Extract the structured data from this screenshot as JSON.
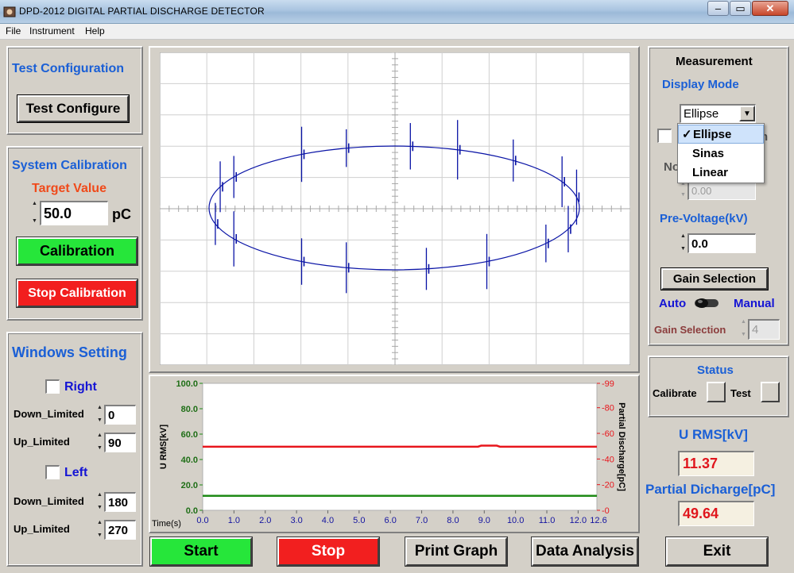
{
  "window": {
    "title": "DPD-2012   DIGITAL  PARTIAL  DISCHARGE  DETECTOR",
    "minimize_glyph": "–",
    "maximize_glyph": "▭",
    "close_glyph": "✕"
  },
  "menu": [
    "File",
    "Instrument",
    "Help"
  ],
  "test_config": {
    "heading": "Test  Configuration",
    "button": "Test Configure"
  },
  "calibration": {
    "heading": "System Calibration",
    "target_label": "Target Value",
    "target_value": "50.0",
    "unit": "pC",
    "calibrate_button": "Calibration",
    "stop_button": "Stop Calibration"
  },
  "windows_setting": {
    "heading": "Windows Setting",
    "right_label": "Right",
    "left_label": "Left",
    "down_label": "Down_Limited",
    "up_label": "Up_Limited",
    "right_down": "0",
    "right_up": "90",
    "left_down": "180",
    "left_up": "270"
  },
  "measurement": {
    "heading": "Measurement",
    "display_mode_label": "Display Mode",
    "display_mode_value": "Ellipse",
    "display_mode_options": [
      "Ellipse",
      "Sinas",
      "Linear"
    ],
    "checkmark": "✓",
    "hidden_label_partial": "No",
    "hidden_label_tail": "n",
    "noise_value": "0.00",
    "pre_voltage_label": "Pre-Voltage(kV)",
    "pre_voltage_value": "0.0",
    "gain_button": "Gain Selection",
    "auto_label": "Auto",
    "manual_label": "Manual",
    "gain_label": "Gain Selection",
    "gain_value": "4"
  },
  "status": {
    "heading": "Status",
    "calibrate_label": "Calibrate",
    "test_label": "Test"
  },
  "readouts": {
    "urms_label": "U RMS[kV]",
    "urms_value": "11.37",
    "pd_label": "Partial Dicharge[pC]",
    "pd_value": "49.64"
  },
  "bottom_buttons": {
    "start": "Start",
    "stop": "Stop",
    "print": "Print Graph",
    "analysis": "Data Analysis",
    "exit": "Exit"
  },
  "colors": {
    "accent_blue": "#1a5fd6",
    "start_green": "#26e63a",
    "stop_red": "#f21f1f",
    "trace_blue": "#0a14a6",
    "pd_red": "#e8161c",
    "urms_green": "#1e8a16"
  },
  "chart_data": [
    {
      "type": "scatter",
      "description_mode": "Ellipse",
      "x_range": [
        0,
        360
      ],
      "ellipse_semi_axes": [
        1.0,
        1.0
      ],
      "pulses": [
        {
          "phase": 20,
          "amp": 0.8
        },
        {
          "phase": 30,
          "amp": 0.6
        },
        {
          "phase": 60,
          "amp": 0.9
        },
        {
          "phase": 75,
          "amp": 0.5
        },
        {
          "phase": 95,
          "amp": 0.7
        },
        {
          "phase": 110,
          "amp": 1.0
        },
        {
          "phase": 130,
          "amp": 0.6
        },
        {
          "phase": 155,
          "amp": 0.8
        },
        {
          "phase": 170,
          "amp": 0.9
        },
        {
          "phase": 200,
          "amp": 0.7
        },
        {
          "phase": 215,
          "amp": 0.5
        },
        {
          "phase": 240,
          "amp": 0.9
        },
        {
          "phase": 260,
          "amp": 0.6
        },
        {
          "phase": 285,
          "amp": 0.8
        },
        {
          "phase": 300,
          "amp": 0.7
        },
        {
          "phase": 330,
          "amp": 0.9
        },
        {
          "phase": 345,
          "amp": 0.6
        }
      ]
    },
    {
      "type": "line",
      "xlabel": "Time(s)",
      "ylabel_left": "U RMS[kV]",
      "ylabel_right": "Partial Discharge[pC]",
      "x_ticks": [
        "0.0",
        "1.0",
        "2.0",
        "3.0",
        "4.0",
        "5.0",
        "6.0",
        "7.0",
        "8.0",
        "9.0",
        "10.0",
        "11.0",
        "12.0"
      ],
      "x_end_label": "12.6",
      "xlim": [
        0,
        12.6
      ],
      "y_left_ticks": [
        "100.0",
        "80.0",
        "60.0",
        "40.0",
        "20.0",
        "0.0"
      ],
      "y_right_ticks": [
        "99",
        "80",
        "60",
        "40",
        "20",
        "0"
      ],
      "ylim_left": [
        0,
        100
      ],
      "ylim_right": [
        0,
        99
      ],
      "series": [
        {
          "name": "U RMS[kV]",
          "axis": "left",
          "x": [
            0,
            12.6
          ],
          "y": [
            11.37,
            11.37
          ]
        },
        {
          "name": "Partial Discharge[pC]",
          "axis": "right",
          "x": [
            0,
            8.8,
            8.9,
            9.4,
            9.5,
            12.6
          ],
          "y": [
            49.6,
            49.6,
            50.4,
            50.4,
            49.6,
            49.6
          ]
        }
      ]
    }
  ]
}
